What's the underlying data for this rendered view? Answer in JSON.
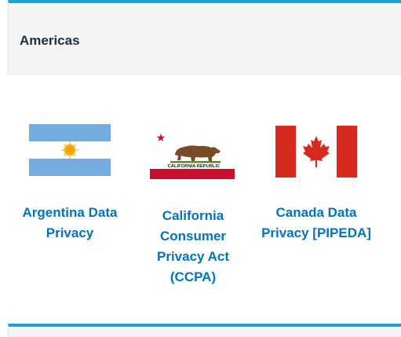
{
  "section": {
    "title": "Americas"
  },
  "cards": [
    {
      "label": "Argentina Data Privacy",
      "flag_icon": "argentina-flag-icon"
    },
    {
      "label": "California Consumer Privacy Act (CCPA)",
      "flag_icon": "california-flag-icon",
      "flag_text": "CALIFORNIA REPUBLIC"
    },
    {
      "label": "Canada Data Privacy [PIPEDA]",
      "flag_icon": "canada-flag-icon"
    }
  ],
  "colors": {
    "accent": "#1fa3d4",
    "link": "#0073bb",
    "header_bg": "#f3f4f5",
    "title": "#232f3e"
  }
}
